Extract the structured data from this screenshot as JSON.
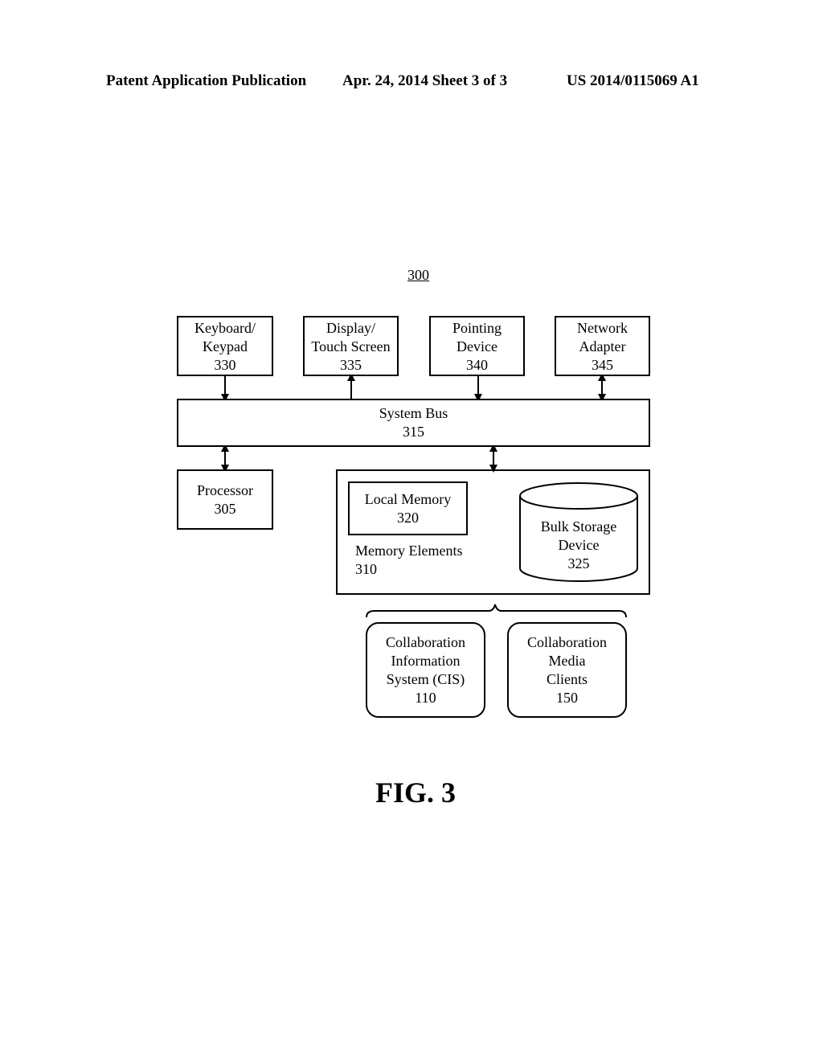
{
  "header": {
    "left": "Patent Application Publication",
    "center": "Apr. 24, 2014  Sheet 3 of 3",
    "right": "US 2014/0115069 A1"
  },
  "figure_ref": "300",
  "boxes": {
    "keyboard": {
      "line1": "Keyboard/",
      "line2": "Keypad",
      "num": "330"
    },
    "display": {
      "line1": "Display/",
      "line2": "Touch Screen",
      "num": "335"
    },
    "pointing": {
      "line1": "Pointing",
      "line2": "Device",
      "num": "340"
    },
    "network": {
      "line1": "Network",
      "line2": "Adapter",
      "num": "345"
    },
    "bus": {
      "line1": "System Bus",
      "num": "315"
    },
    "processor": {
      "line1": "Processor",
      "num": "305"
    },
    "local_memory": {
      "line1": "Local Memory",
      "num": "320"
    },
    "memory_elements": {
      "line1": "Memory Elements",
      "num": "310"
    },
    "bulk_storage": {
      "line1": "Bulk Storage",
      "line2": "Device",
      "num": "325"
    },
    "cis": {
      "line1": "Collaboration",
      "line2": "Information",
      "line3": "System (CIS)",
      "num": "110"
    },
    "media_clients": {
      "line1": "Collaboration",
      "line2": "Media",
      "line3": "Clients",
      "num": "150"
    }
  },
  "caption": "FIG. 3"
}
